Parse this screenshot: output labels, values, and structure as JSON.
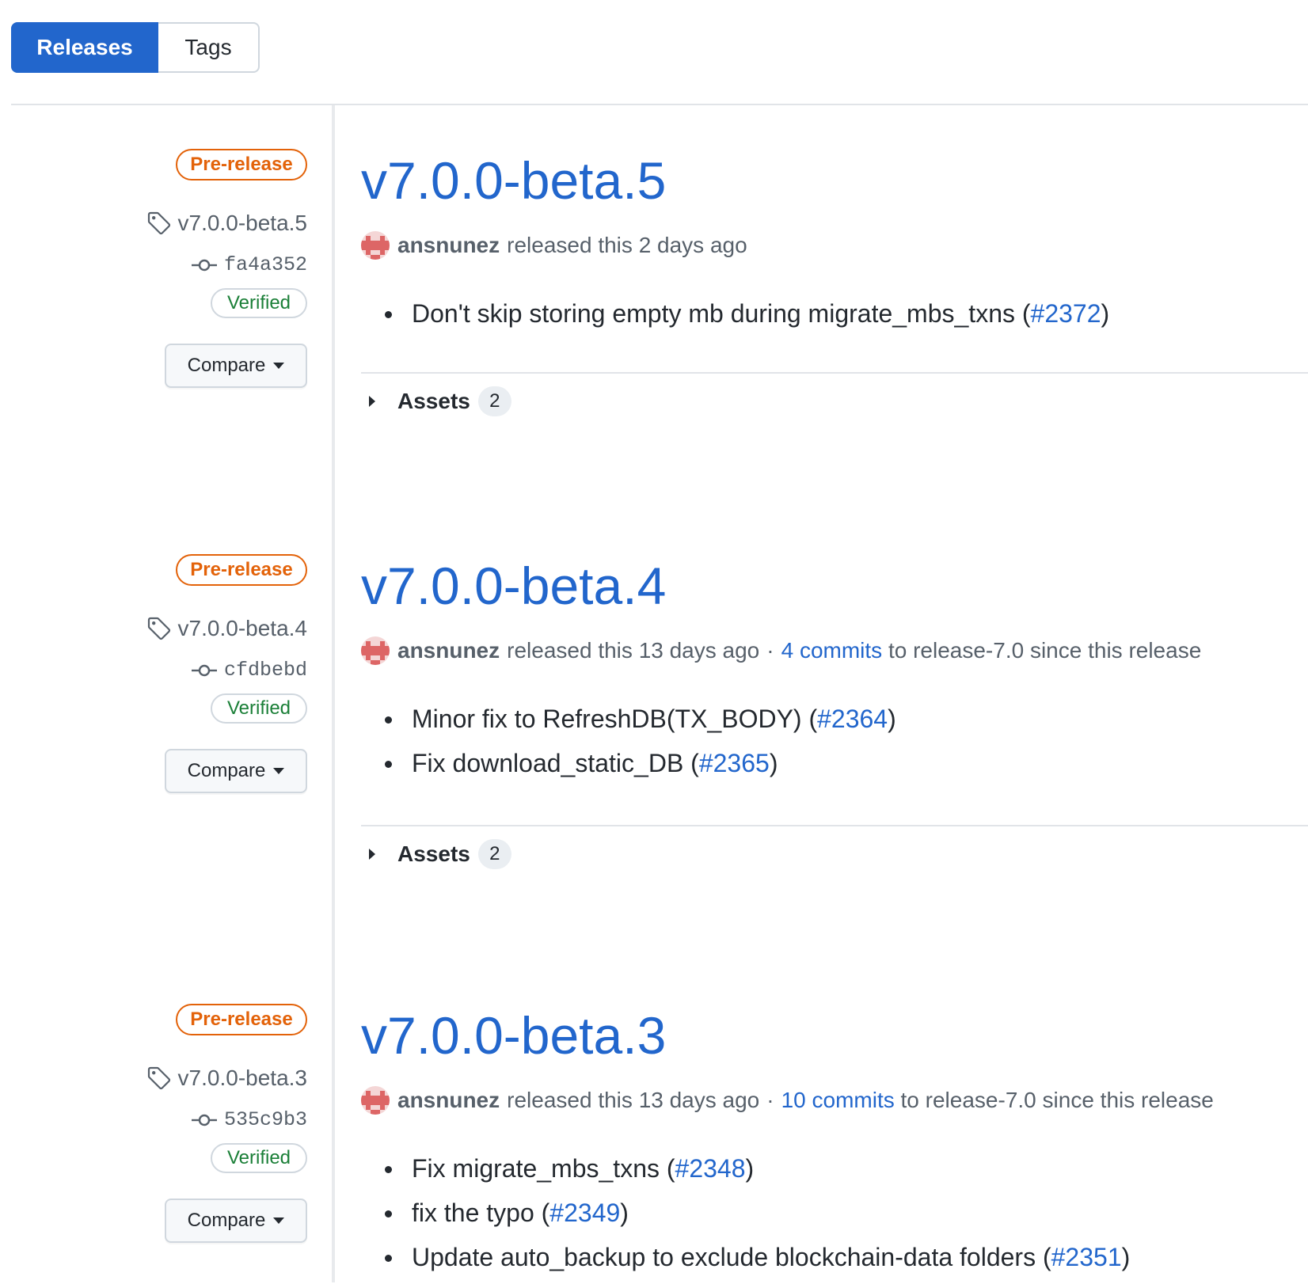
{
  "tabs": {
    "releases": "Releases",
    "tags": "Tags"
  },
  "labels": {
    "prerelease": "Pre-release",
    "verified": "Verified",
    "compare": "Compare",
    "assets": "Assets",
    "released_this": "released this"
  },
  "releases": [
    {
      "title": "v7.0.0-beta.5",
      "tag": "v7.0.0-beta.5",
      "commit": "fa4a352",
      "author": "ansnunez",
      "when": "2 days ago",
      "commits_link": "",
      "commits_suffix": "",
      "notes": [
        {
          "text": "Don't skip storing empty mb during migrate_mbs_txns (",
          "pr": "#2372",
          "close": ")"
        }
      ],
      "assets_count": "2"
    },
    {
      "title": "v7.0.0-beta.4",
      "tag": "v7.0.0-beta.4",
      "commit": "cfdbebd",
      "author": "ansnunez",
      "when": "13 days ago",
      "commits_link": "4 commits",
      "commits_suffix": "to release-7.0 since this release",
      "notes": [
        {
          "text": "Minor fix to RefreshDB(TX_BODY) (",
          "pr": "#2364",
          "close": ")"
        },
        {
          "text": "Fix download_static_DB (",
          "pr": "#2365",
          "close": ")"
        }
      ],
      "assets_count": "2"
    },
    {
      "title": "v7.0.0-beta.3",
      "tag": "v7.0.0-beta.3",
      "commit": "535c9b3",
      "author": "ansnunez",
      "when": "13 days ago",
      "commits_link": "10 commits",
      "commits_suffix": "to release-7.0 since this release",
      "notes": [
        {
          "text": "Fix migrate_mbs_txns (",
          "pr": "#2348",
          "close": ")"
        },
        {
          "text": "fix the typo (",
          "pr": "#2349",
          "close": ")"
        },
        {
          "text": "Update auto_backup to exclude blockchain-data folders (",
          "pr": "#2351",
          "close": ")"
        }
      ]
    }
  ],
  "colors": {
    "accent": "#2266cc",
    "prerelease": "#e36209",
    "verified": "#1a7f37"
  },
  "icons": {
    "tag": "tag-icon",
    "commit": "git-commit-icon",
    "assets_toggle": "triangle-right-icon"
  }
}
